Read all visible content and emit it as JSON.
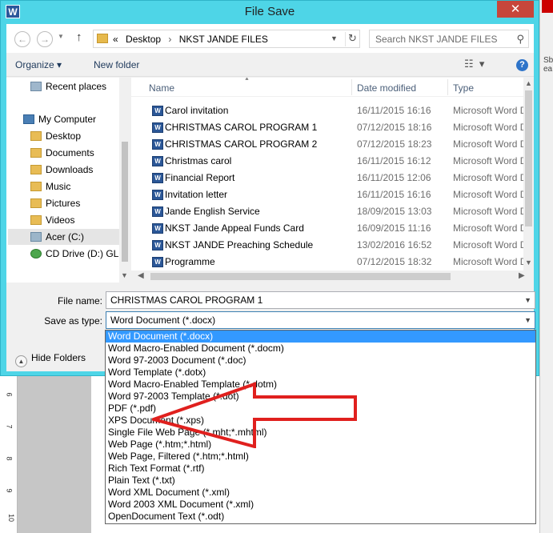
{
  "window": {
    "title": "File Save",
    "app_icon": "W",
    "close_glyph": "✕"
  },
  "address": {
    "crumbs": [
      "«",
      "Desktop",
      "›",
      "NKST JANDE FILES"
    ],
    "search_placeholder": "Search NKST JANDE FILES"
  },
  "toolbar": {
    "organize": "Organize ▾",
    "new_folder": "New folder",
    "help": "?"
  },
  "nav": {
    "items": [
      {
        "label": "Recent places",
        "icon": "recent-places-icon"
      },
      {
        "label": "My Computer",
        "icon": "computer-icon"
      },
      {
        "label": "Desktop",
        "icon": "folder-icon"
      },
      {
        "label": "Documents",
        "icon": "folder-icon"
      },
      {
        "label": "Downloads",
        "icon": "folder-icon"
      },
      {
        "label": "Music",
        "icon": "folder-icon"
      },
      {
        "label": "Pictures",
        "icon": "folder-icon"
      },
      {
        "label": "Videos",
        "icon": "folder-icon"
      },
      {
        "label": "Acer (C:)",
        "icon": "drive-icon"
      },
      {
        "label": "CD Drive (D:) GLO",
        "icon": "cd-drive-icon"
      }
    ]
  },
  "files": {
    "headers": {
      "name": "Name",
      "date": "Date modified",
      "type": "Type"
    },
    "rows": [
      {
        "name": "Carol invitation",
        "date": "16/11/2015 16:16",
        "type": "Microsoft Word D"
      },
      {
        "name": "CHRISTMAS CAROL PROGRAM 1",
        "date": "07/12/2015 18:16",
        "type": "Microsoft Word D"
      },
      {
        "name": "CHRISTMAS CAROL PROGRAM 2",
        "date": "07/12/2015 18:23",
        "type": "Microsoft Word D"
      },
      {
        "name": "Christmas carol",
        "date": "16/11/2015 16:12",
        "type": "Microsoft Word D"
      },
      {
        "name": "Financial Report",
        "date": "16/11/2015 12:06",
        "type": "Microsoft Word D"
      },
      {
        "name": "Invitation letter",
        "date": "16/11/2015 16:16",
        "type": "Microsoft Word D"
      },
      {
        "name": "Jande English Service",
        "date": "18/09/2015 13:03",
        "type": "Microsoft Word D"
      },
      {
        "name": "NKST Jande Appeal Funds Card",
        "date": "16/09/2015 11:16",
        "type": "Microsoft Word D"
      },
      {
        "name": "NKST JANDE Preaching Schedule",
        "date": "13/02/2016 16:52",
        "type": "Microsoft Word D"
      },
      {
        "name": "Programme",
        "date": "07/12/2015 18:32",
        "type": "Microsoft Word D"
      }
    ]
  },
  "form": {
    "file_name_label": "File name:",
    "file_name_value": "CHRISTMAS CAROL PROGRAM 1",
    "save_type_label": "Save as type:",
    "save_type_value": "Word Document (*.docx)",
    "hide_folders": "Hide Folders"
  },
  "dropdown": {
    "selected_index": 0,
    "options": [
      "Word Document (*.docx)",
      "Word Macro-Enabled Document (*.docm)",
      "Word 97-2003 Document (*.doc)",
      "Word Template (*.dotx)",
      "Word Macro-Enabled Template (*.dotm)",
      "Word 97-2003 Template (*.dot)",
      "PDF (*.pdf)",
      "XPS Document (*.xps)",
      "Single File Web Page (*.mht;*.mhtml)",
      "Web Page (*.htm;*.html)",
      "Web Page, Filtered (*.htm;*.html)",
      "Rich Text Format (*.rtf)",
      "Plain Text (*.txt)",
      "Word XML Document (*.xml)",
      "Word 2003 XML Document (*.xml)",
      "OpenDocument Text (*.odt)"
    ]
  },
  "background": {
    "ruler_marks": [
      "6",
      "7",
      "8",
      "9",
      "10"
    ],
    "right_edge_text": [
      "Sb",
      "ea"
    ]
  },
  "colors": {
    "window_frame": "#4ed5e7",
    "close_button": "#c7463b",
    "selection": "#3399ff",
    "annotation_arrow": "#e0201e"
  }
}
